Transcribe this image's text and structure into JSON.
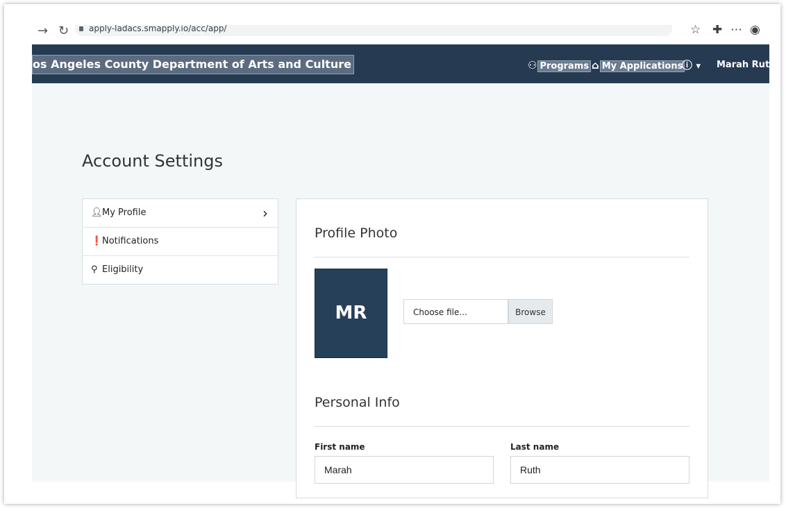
{
  "browser": {
    "url": "apply-ladacs.smapply.io/acc/app/",
    "back_glyph": "→",
    "reload_glyph": "↻"
  },
  "navbar": {
    "brand": "os Angeles County Department of Arts and Culture",
    "programs_label": "Programs",
    "applications_label": "My Applications",
    "user_name": "Marah Ruth"
  },
  "page": {
    "title": "Account Settings"
  },
  "sidebar": {
    "items": [
      {
        "label": "My Profile",
        "icon": "user-icon"
      },
      {
        "label": "Notifications",
        "icon": "alert-icon"
      },
      {
        "label": "Eligibility",
        "icon": "user-add-icon"
      }
    ]
  },
  "profile_photo": {
    "section_title": "Profile Photo",
    "initials": "MR",
    "file_placeholder": "Choose file...",
    "browse_label": "Browse"
  },
  "personal_info": {
    "section_title": "Personal Info",
    "first_name_label": "First name",
    "first_name_value": "Marah",
    "last_name_label": "Last name",
    "last_name_value": "Ruth"
  },
  "colors": {
    "navbar": "#263b52",
    "avatar": "#27405a",
    "content_bg": "#f4f7f8"
  }
}
